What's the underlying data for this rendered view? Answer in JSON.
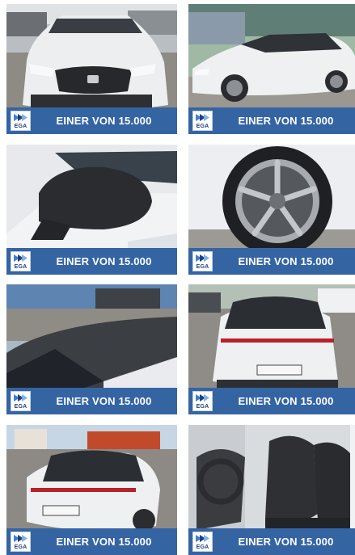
{
  "gallery": {
    "tiles": [
      {
        "banner_text": "EINER VON 15.000",
        "badge_text": "EGA",
        "icon": "car-front-photo"
      },
      {
        "banner_text": "EINER VON 15.000",
        "badge_text": "EGA",
        "icon": "car-side-photo"
      },
      {
        "banner_text": "EINER VON 15.000",
        "badge_text": "EGA",
        "icon": "side-mirror-photo"
      },
      {
        "banner_text": "EINER VON 15.000",
        "badge_text": "EGA",
        "icon": "wheel-rim-photo"
      },
      {
        "banner_text": "EINER VON 15.000",
        "badge_text": "EGA",
        "icon": "roof-photo"
      },
      {
        "banner_text": "EINER VON 15.000",
        "badge_text": "EGA",
        "icon": "car-rear-photo"
      },
      {
        "banner_text": "EINER VON 15.000",
        "badge_text": "EGA",
        "icon": "car-rear-quarter-photo"
      },
      {
        "banner_text": "EINER VON 15.000",
        "badge_text": "EGA",
        "icon": "interior-seats-photo"
      }
    ]
  },
  "colors": {
    "banner_blue": "#3564a3",
    "banner_text": "#ffffff",
    "badge_blue": "#1f3f77",
    "car_white": "#f1f2f4",
    "car_black": "#2a2c30"
  }
}
